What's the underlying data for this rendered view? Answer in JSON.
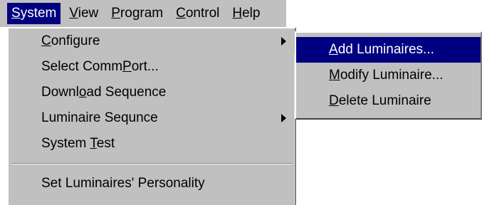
{
  "menubar": {
    "items": [
      {
        "pre": "",
        "key": "S",
        "post": "ystem",
        "active": true
      },
      {
        "pre": "",
        "key": "V",
        "post": "iew",
        "active": false
      },
      {
        "pre": "",
        "key": "P",
        "post": "rogram",
        "active": false
      },
      {
        "pre": "",
        "key": "C",
        "post": "ontrol",
        "active": false
      },
      {
        "pre": "",
        "key": "H",
        "post": "elp",
        "active": false
      }
    ]
  },
  "system_menu": {
    "items": [
      {
        "pre": "",
        "key": "C",
        "post": "onfigure",
        "has_submenu": true
      },
      {
        "pre": "Select Comm",
        "key": "P",
        "post": "ort...",
        "has_submenu": false
      },
      {
        "pre": "Downl",
        "key": "o",
        "post": "ad Sequence",
        "has_submenu": false
      },
      {
        "pre": "Luminaire Sequnce",
        "key": "",
        "post": "",
        "has_submenu": true
      },
      {
        "pre": "System ",
        "key": "T",
        "post": "est",
        "has_submenu": false
      },
      {
        "pre": "Set Luminaires' Personality",
        "key": "",
        "post": "",
        "has_submenu": false
      }
    ]
  },
  "configure_submenu": {
    "items": [
      {
        "pre": "",
        "key": "A",
        "post": "dd Luminaires...",
        "highlighted": true
      },
      {
        "pre": "",
        "key": "M",
        "post": "odify Luminaire...",
        "highlighted": false
      },
      {
        "pre": "",
        "key": "D",
        "post": "elete Luminaire",
        "highlighted": false
      }
    ]
  },
  "colors": {
    "menu_face": "#c0c0c0",
    "highlight": "#000080",
    "highlight_text": "#ffffff"
  }
}
